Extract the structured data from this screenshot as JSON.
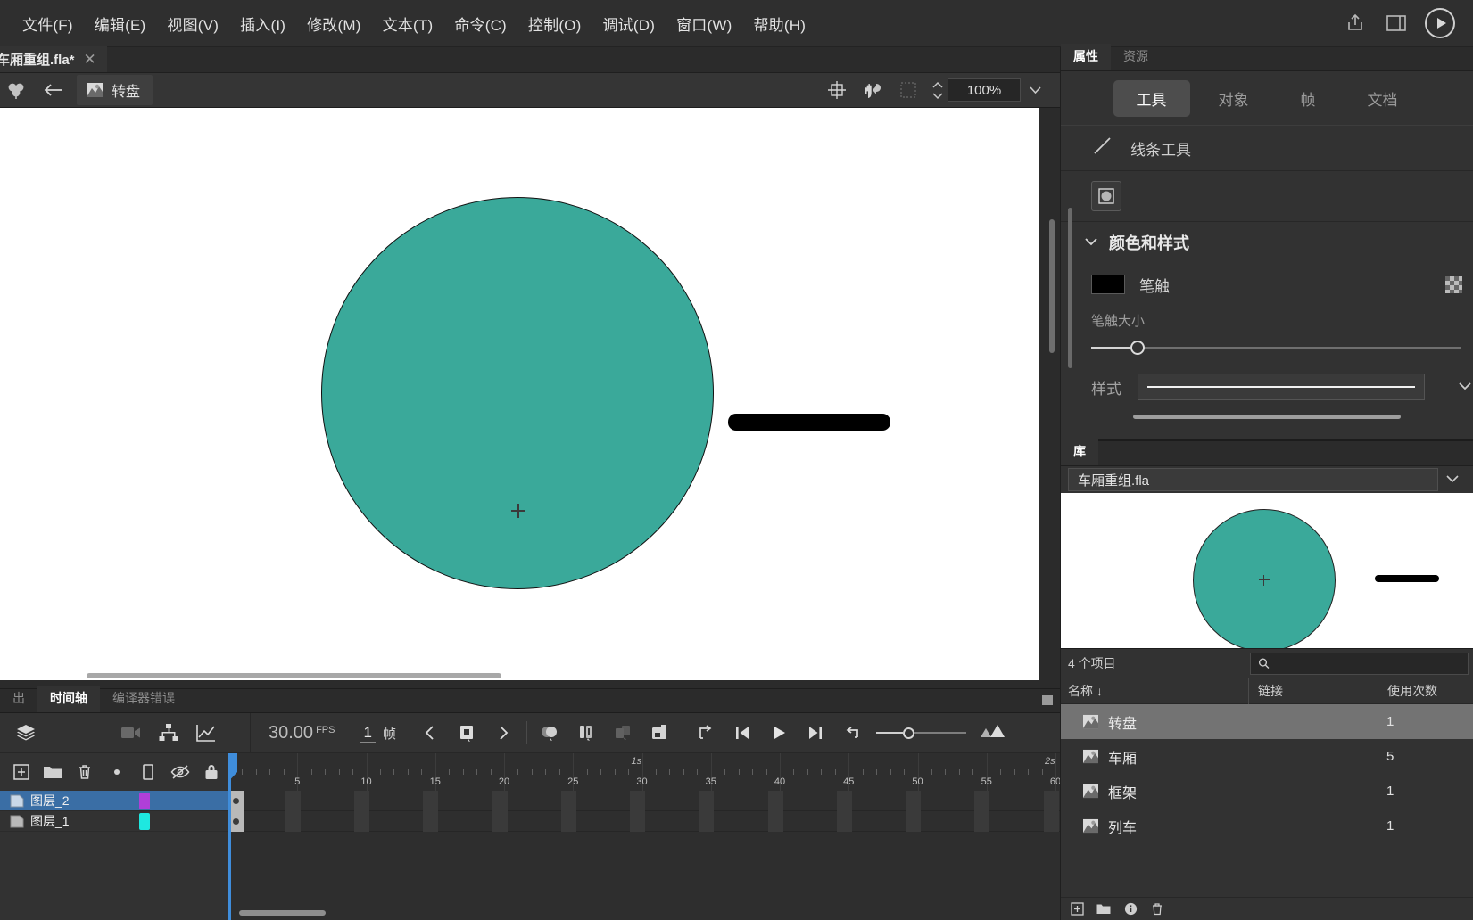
{
  "menubar": {
    "items": [
      {
        "label": "文件(F)",
        "name": "menu-file"
      },
      {
        "label": "编辑(E)",
        "name": "menu-edit"
      },
      {
        "label": "视图(V)",
        "name": "menu-view"
      },
      {
        "label": "插入(I)",
        "name": "menu-insert"
      },
      {
        "label": "修改(M)",
        "name": "menu-modify"
      },
      {
        "label": "文本(T)",
        "name": "menu-text"
      },
      {
        "label": "命令(C)",
        "name": "menu-commands"
      },
      {
        "label": "控制(O)",
        "name": "menu-control"
      },
      {
        "label": "调试(D)",
        "name": "menu-debug"
      },
      {
        "label": "窗口(W)",
        "name": "menu-window"
      },
      {
        "label": "帮助(H)",
        "name": "menu-help"
      }
    ],
    "right_icons": [
      "share-icon",
      "workspace-icon",
      "play-circle-icon"
    ]
  },
  "document_tab": {
    "title": "车厢重组.fla*",
    "close": "✕"
  },
  "editbar": {
    "breadcrumb_symbol": "转盘",
    "back_icon": "back-arrow-icon",
    "scene_icon": "clover-icon",
    "zoom_value": "100%",
    "tools": [
      "center-stage-icon",
      "rotate-hand-icon",
      "clip-content-icon"
    ]
  },
  "stage": {
    "shapes": [
      {
        "name": "teal-disc",
        "fill": "#3aa99a",
        "stroke": "#111111"
      },
      {
        "name": "black-bar",
        "fill": "#000000"
      }
    ],
    "background": "#ffffff"
  },
  "timeline": {
    "tabs": [
      {
        "label": "出",
        "active": false,
        "name": "tab-output"
      },
      {
        "label": "时间轴",
        "active": true,
        "name": "tab-timeline"
      },
      {
        "label": "编译器错误",
        "active": false,
        "name": "tab-compiler-errors"
      }
    ],
    "fps": "30.00",
    "fps_unit": "FPS",
    "current_frame": "1",
    "frame_unit": "帧",
    "left_tools": [
      "layers-stack-icon",
      "camera-icon",
      "layer-parenting-icon",
      "graph-editor-icon"
    ],
    "playback": [
      {
        "name": "prev-keyframe-icon",
        "glyph": "‹"
      },
      {
        "name": "insert-keyframe-icon"
      },
      {
        "name": "next-keyframe-icon",
        "glyph": "›"
      },
      {
        "name": "onion-skin-icon"
      },
      {
        "name": "onion-skin-outlines-icon"
      },
      {
        "name": "edit-multiple-frames-icon"
      },
      {
        "name": "modify-markers-icon"
      },
      {
        "name": "loop-playback-icon"
      },
      {
        "name": "step-back-icon"
      },
      {
        "name": "play-icon"
      },
      {
        "name": "step-forward-icon"
      },
      {
        "name": "reverse-icon"
      }
    ],
    "ruler": {
      "numbers": [
        5,
        10,
        15,
        20,
        25,
        30,
        35,
        40,
        45,
        50,
        55,
        60
      ],
      "second_marks": [
        {
          "label": "1s",
          "frame": 30
        },
        {
          "label": "2s",
          "frame": 60
        }
      ]
    },
    "layer_tools": [
      {
        "name": "add-layer-icon"
      },
      {
        "name": "add-folder-icon"
      },
      {
        "name": "delete-layer-icon"
      },
      {
        "name": "dot-marker-icon"
      },
      {
        "name": "outline-view-icon"
      },
      {
        "name": "hide-layer-icon"
      },
      {
        "name": "lock-layer-icon"
      }
    ],
    "layers": [
      {
        "name": "图层_2",
        "selected": true,
        "chip_color": "#b03fd8"
      },
      {
        "name": "图层_1",
        "selected": false,
        "chip_color": "#1ee8e0"
      }
    ]
  },
  "properties": {
    "panel_tabs": [
      {
        "label": "属性",
        "active": true,
        "name": "tab-properties"
      },
      {
        "label": "资源",
        "active": false,
        "name": "tab-assets"
      }
    ],
    "segments": [
      {
        "label": "工具",
        "active": true,
        "name": "seg-tool"
      },
      {
        "label": "对象",
        "active": false,
        "name": "seg-object"
      },
      {
        "label": "帧",
        "active": false,
        "name": "seg-frame"
      },
      {
        "label": "文档",
        "active": false,
        "name": "seg-document"
      }
    ],
    "tool_name": "线条工具",
    "tool_icon": "line-tool-icon",
    "object_draw_icon": "object-drawing-icon",
    "section": {
      "title": "颜色和样式",
      "stroke_label": "笔触",
      "stroke_color": "#000000",
      "stroke_size_label": "笔触大小",
      "style_label": "样式"
    }
  },
  "library": {
    "tab_label": "库",
    "document_name": "车厢重组.fla",
    "item_count": "4 个项目",
    "search_placeholder": "",
    "columns": {
      "name": "名称",
      "sort_arrow": "↓",
      "link": "链接",
      "use_count": "使用次数"
    },
    "items": [
      {
        "name": "转盘",
        "link": "",
        "count": "1",
        "selected": true,
        "icon": "movieclip-icon"
      },
      {
        "name": "车厢",
        "link": "",
        "count": "5",
        "selected": false,
        "icon": "movieclip-icon"
      },
      {
        "name": "框架",
        "link": "",
        "count": "1",
        "selected": false,
        "icon": "movieclip-icon"
      },
      {
        "name": "列车",
        "link": "",
        "count": "1",
        "selected": false,
        "icon": "movieclip-icon"
      }
    ],
    "footer_icons": [
      "new-symbol-icon",
      "new-folder-icon",
      "properties-icon",
      "delete-icon"
    ]
  },
  "colors": {
    "accent_teal": "#3aa99a",
    "selection_blue": "#3a6ea5",
    "playhead_blue": "#3f8ddb",
    "panel_bg": "#323232",
    "dark_bg": "#2b2b2b"
  }
}
